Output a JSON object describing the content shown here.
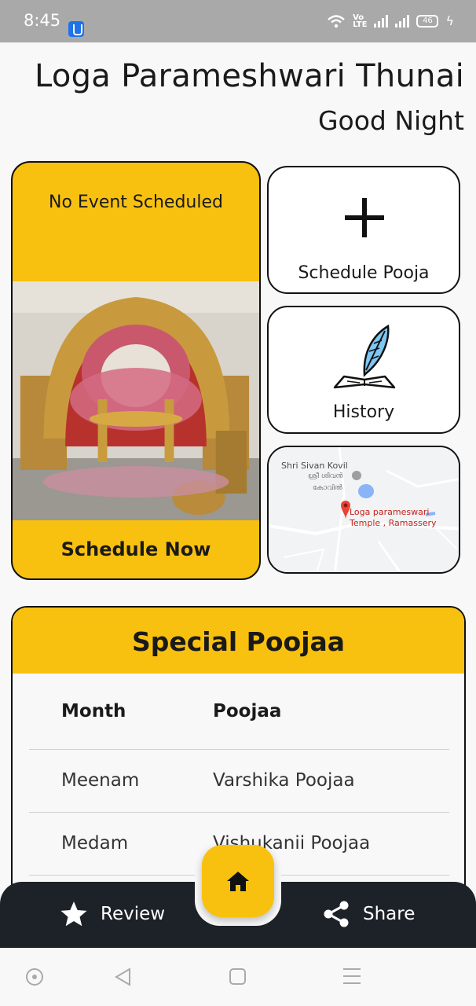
{
  "status_bar": {
    "time": "8:45",
    "network_label_top": "Vo",
    "network_label_bottom": "LTE",
    "battery": "46"
  },
  "header": {
    "title": "Loga Parameshwari Thunai",
    "greeting": "Good Night"
  },
  "event_card": {
    "status": "No Event Scheduled",
    "action_label": "Schedule Now",
    "accent_color": "#f9c10f"
  },
  "tiles": {
    "schedule": {
      "label": "Schedule Pooja",
      "icon": "plus-icon"
    },
    "history": {
      "label": "History",
      "icon": "quill-book-icon"
    }
  },
  "map": {
    "place_1": "Shri Sivan Kovil",
    "place_1_local_line_1": "ശ്രീ ശിവൻ",
    "place_1_local_line_2": "കോവിൽ",
    "pin_label_line_1": "Loga parameswari",
    "pin_label_line_2": "Temple , Ramassery"
  },
  "special_poojaa": {
    "title": "Special Poojaa",
    "columns": [
      "Month",
      "Poojaa"
    ],
    "rows": [
      [
        "Meenam",
        "Varshika Poojaa"
      ],
      [
        "Medam",
        "Vishukanii Poojaa"
      ]
    ]
  },
  "bottom_nav": {
    "review_label": "Review",
    "share_label": "Share",
    "home_icon": "home-icon",
    "background": "#1d2229"
  }
}
